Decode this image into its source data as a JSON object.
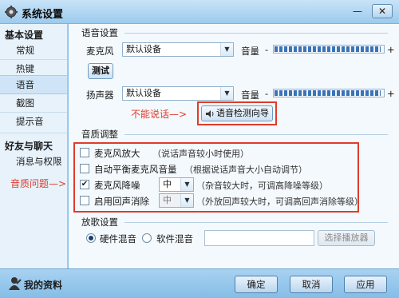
{
  "window": {
    "title": "系统设置"
  },
  "sidebar": {
    "sections": [
      {
        "title": "基本设置",
        "items": [
          "常规",
          "热键",
          "语音",
          "截图",
          "提示音"
        ]
      },
      {
        "title": "好友与聊天",
        "items": [
          "消息与权限"
        ]
      }
    ]
  },
  "voice": {
    "group_title": "语音设置",
    "mic_label": "麦克风",
    "mic_device": "默认设备",
    "volume_label": "音量",
    "volume_minus": "-",
    "volume_plus": "+",
    "mic_volume": 0.98,
    "test_button": "测试",
    "speaker_label": "扬声器",
    "speaker_device": "默认设备",
    "speaker_volume": 0.98,
    "wizard_button": "语音检测向导",
    "annotation_no_talk": "不能说话—>"
  },
  "quality": {
    "group_title": "音质调整",
    "annotation": "音质问题—>",
    "options": [
      {
        "label": "麦克风放大",
        "hint": "（说话声音较小时使用）",
        "checked": false
      },
      {
        "label": "自动平衡麦克风音量",
        "hint": "（根据说话声音大小自动调节）",
        "checked": false
      },
      {
        "label": "麦克风降噪",
        "level": "中",
        "hint": "（杂音较大时，可调高降噪等级）",
        "checked": true
      },
      {
        "label": "启用回声消除",
        "level": "中",
        "hint": "（外放回声较大时，可调高回声消除等级）",
        "checked": false
      }
    ]
  },
  "playback": {
    "group_title": "放歌设置",
    "hardware_mix": "硬件混音",
    "software_mix": "软件混音",
    "selected": "硬件混音",
    "select_player": "选择播放器"
  },
  "footer": {
    "profile": "我的资料",
    "ok": "确定",
    "cancel": "取消",
    "apply": "应用"
  },
  "colors": {
    "accent": "#3a74b8",
    "annotation": "#e03b2c"
  }
}
